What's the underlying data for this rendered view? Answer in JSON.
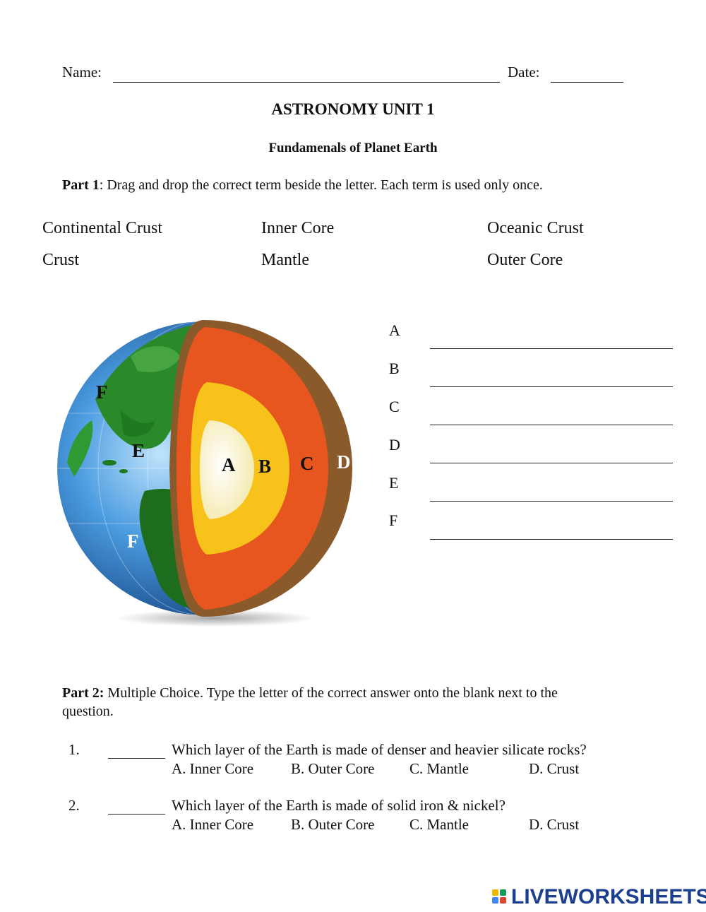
{
  "header": {
    "name_label": "Name:",
    "date_label": "Date:"
  },
  "title": "ASTRONOMY UNIT 1",
  "subtitle": "Fundamenals of Planet Earth",
  "part1": {
    "label": "Part 1",
    "instructions": ":  Drag and drop the correct term beside the letter.  Each term is used only once.",
    "terms": [
      "Continental Crust",
      "Inner Core",
      "Oceanic Crust",
      "Crust",
      "Mantle",
      "Outer Core"
    ],
    "answer_letters": [
      "A",
      "B",
      "C",
      "D",
      "E",
      "F"
    ]
  },
  "diagram": {
    "labels": [
      "A",
      "B",
      "C",
      "D",
      "E",
      "F",
      "F"
    ]
  },
  "part2": {
    "label": "Part 2:",
    "instructions": "  Multiple Choice.   Type the letter of the correct answer onto the blank next to the",
    "instructions_line2": "question.",
    "questions": [
      {
        "number": "1.",
        "text": "Which layer of the Earth is made of denser and heavier silicate rocks?",
        "options": [
          "A.  Inner Core",
          "B.  Outer Core",
          "C.  Mantle",
          "D.  Crust"
        ]
      },
      {
        "number": "2.",
        "text": "Which layer of the Earth is made of solid iron & nickel?",
        "options": [
          "A.  Inner Core",
          "B.  Outer Core",
          "C.  Mantle",
          "D.  Crust"
        ]
      }
    ]
  },
  "logo": {
    "text": "LIVEWORKSHEETS",
    "color": "#1c3f8f"
  },
  "colors": {
    "ocean": "#3f8fd6",
    "land": "#2a8a2a",
    "crust": "#8b5a2b",
    "mantle": "#e8561f",
    "outer_core": "#f7c31a",
    "inner_core": "#fbf6d8"
  }
}
